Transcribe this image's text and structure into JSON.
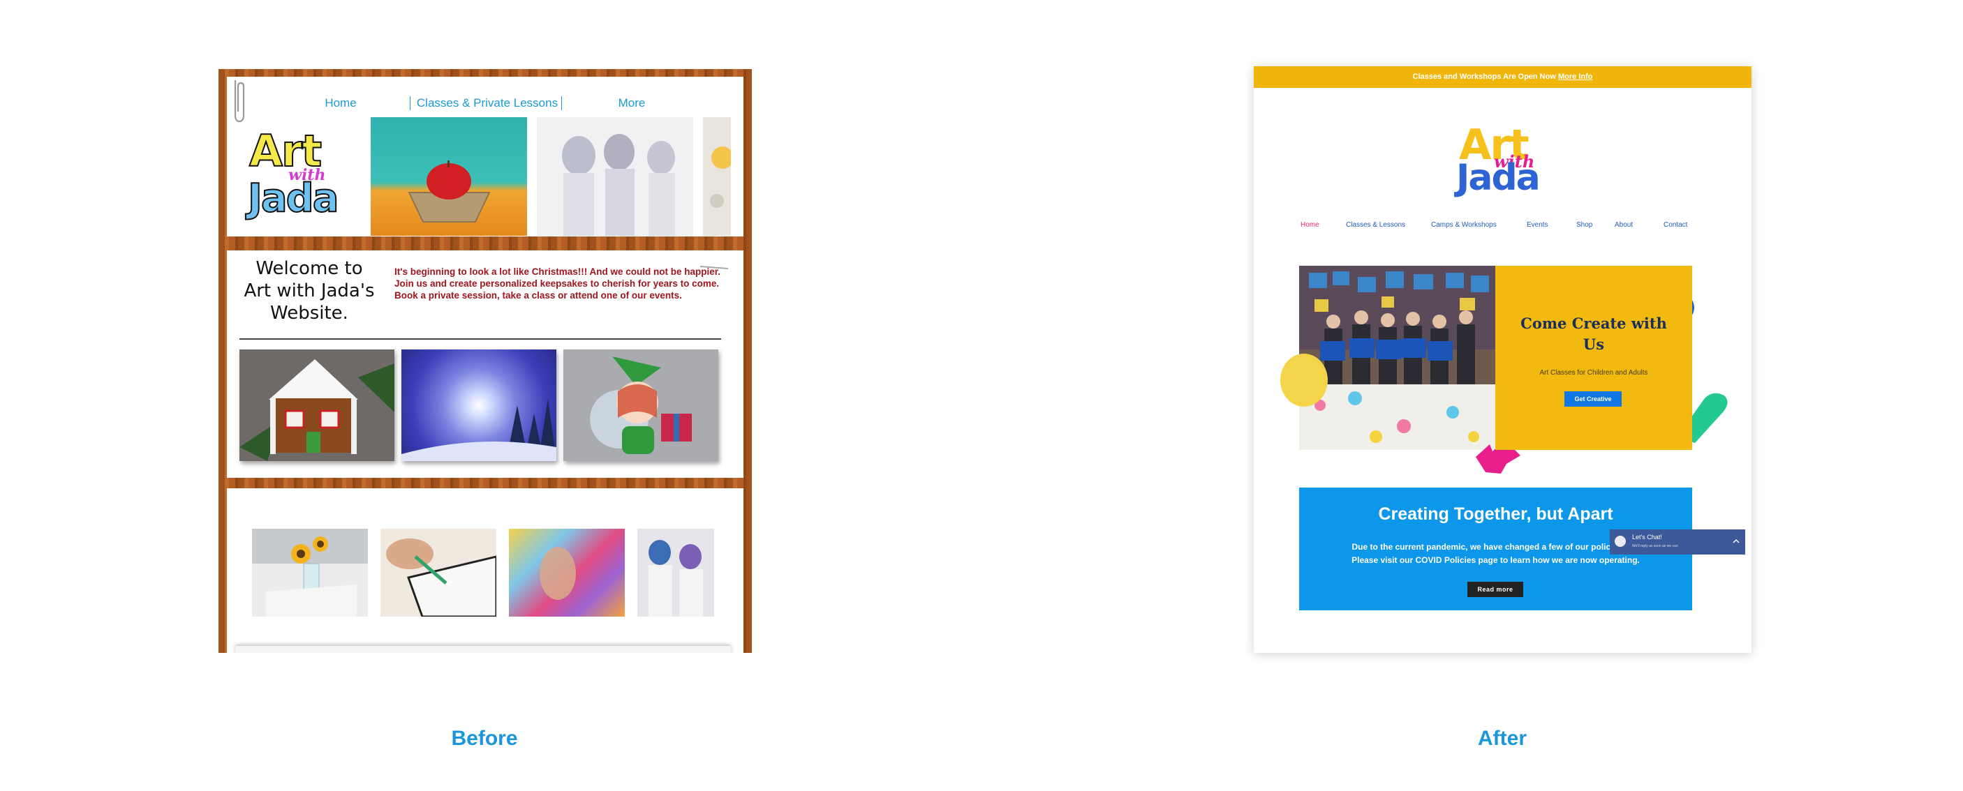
{
  "before": {
    "nav": {
      "home": "Home",
      "classes": "Classes & Private Lessons",
      "more": "More"
    },
    "logo": {
      "line1": "Art",
      "line2": "with",
      "line3": "Jada"
    },
    "welcome_title": "Welcome to Art with Jada's Website.",
    "welcome_text": "It's beginning to look a lot like Christmas!!!  And we could not be happier.  Join us and create personalized keepsakes to cherish for years to come.  Book a private session, take a class or attend one of our events."
  },
  "after": {
    "banner": {
      "text": "Classes and Workshops Are Open Now",
      "link": "More Info"
    },
    "logo": {
      "line1": "Art",
      "line2": "with",
      "line3": "Jada"
    },
    "nav": [
      "Home",
      "Classes & Lessons",
      "Camps & Workshops",
      "Events",
      "Shop",
      "About",
      "Contact"
    ],
    "hero": {
      "title": "Come Create with Us",
      "subtitle": "Art Classes for Children and Adults",
      "button": "Get Creative"
    },
    "covid": {
      "title": "Creating Together, but Apart",
      "line1": "Due to the current pandemic, we have changed a few of our policies and",
      "line2": "Please visit our COVID Policies page to learn how we are now operating.",
      "button": "Read more"
    },
    "chat": {
      "title": "Let's Chat!",
      "subtitle": "We'll reply as soon as we can"
    }
  },
  "captions": {
    "before": "Before",
    "after": "After"
  },
  "colors": {
    "accent_blue": "#1a96dc",
    "banner_yellow": "#f1b60b",
    "covid_blue": "#0d97ea",
    "chat_bg": "#3c5a9a"
  }
}
